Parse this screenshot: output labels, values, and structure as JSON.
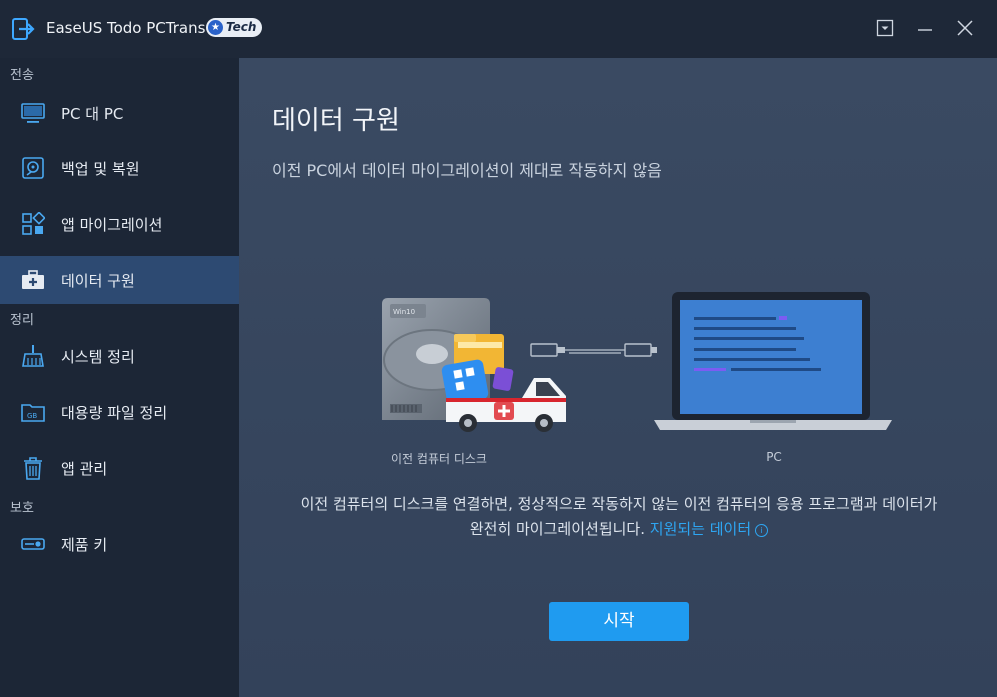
{
  "app": {
    "title": "EaseUS Todo PCTrans",
    "badge": "Tech"
  },
  "sidebar": {
    "sections": [
      {
        "label": "전송"
      },
      {
        "label": "정리"
      },
      {
        "label": "보호"
      }
    ],
    "items": [
      {
        "label": "PC 대 PC",
        "icon": "monitor-icon"
      },
      {
        "label": "백업 및 복원",
        "icon": "backup-restore-icon"
      },
      {
        "label": "앱 마이그레이션",
        "icon": "app-grid-icon"
      },
      {
        "label": "데이터 구원",
        "icon": "first-aid-kit-icon",
        "active": true
      },
      {
        "label": "시스템 정리",
        "icon": "broom-icon"
      },
      {
        "label": "대용량 파일 정리",
        "icon": "folder-gb-icon"
      },
      {
        "label": "앱 관리",
        "icon": "trash-icon"
      },
      {
        "label": "제품 키",
        "icon": "key-icon"
      }
    ]
  },
  "main": {
    "title": "데이터 구원",
    "subtitle": "이전 PC에서 데이터 마이그레이션이 제대로 작동하지 않음",
    "left_caption": "이전 컴퓨터 디스크",
    "right_caption": "PC",
    "disk_label": "Win10",
    "description_text": "이전 컴퓨터의 디스크를 연결하면, 정상적으로 작동하지 않는 이전 컴퓨터의 응용 프로그램과 데이터가 완전히 마이그레이션됩니다.",
    "description_link": "지원되는 데이터",
    "start_button": "시작"
  },
  "colors": {
    "accent": "#1f9bf0",
    "link": "#2ea6f2",
    "sidebar_active": "#2d4a72"
  }
}
